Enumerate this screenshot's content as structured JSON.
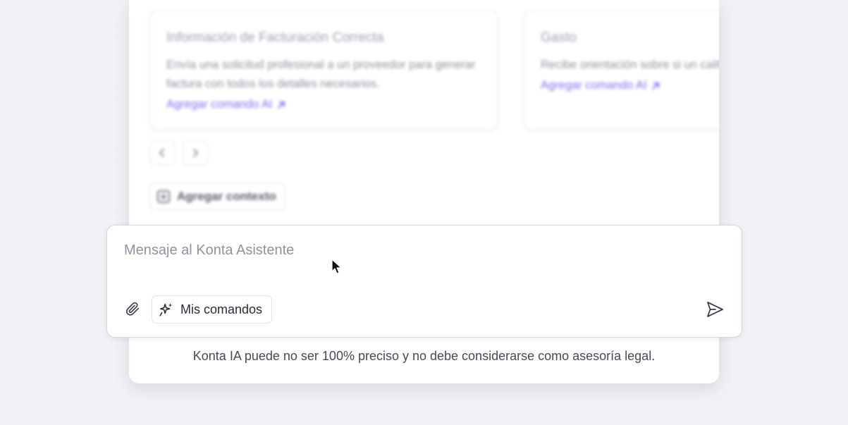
{
  "carousel": {
    "cards": [
      {
        "title": "Información de Facturación Correcta",
        "description": "Envía una solicitud profesional a un proveedor para generar factura con todos los detalles necesarios.",
        "link": "Agregar comando AI"
      },
      {
        "title": "Gasto",
        "description": "Recibe orientación sobre si un califica como deducción empr",
        "link": "Agregar comando AI"
      }
    ],
    "prev_icon": "chevron-left-icon",
    "next_icon": "chevron-right-icon"
  },
  "context": {
    "add_label": "Agregar contexto",
    "icon": "plus-square-icon"
  },
  "composer": {
    "placeholder": "Mensaje al Konta Asistente",
    "value": "",
    "commands_label": "Mis comandos",
    "attach_icon": "paperclip-icon",
    "commands_icon": "sparkles-icon",
    "send_icon": "send-icon"
  },
  "disclaimer": "Konta IA puede no ser 100% preciso y no debe considerarse como asesoría legal.",
  "colors": {
    "accent": "#7e6df0",
    "background": "#f1f2f6",
    "panel": "#ffffff"
  }
}
